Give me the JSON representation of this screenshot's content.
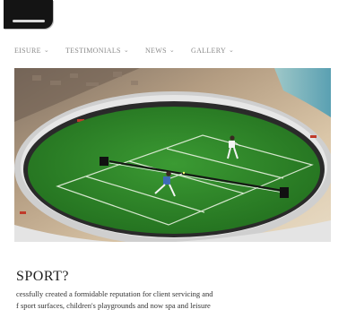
{
  "nav": {
    "items": [
      {
        "label": "EISURE",
        "chev": "⌄"
      },
      {
        "label": "TESTIMONIALS",
        "chev": "⌄"
      },
      {
        "label": "NEWS",
        "chev": "⌄"
      },
      {
        "label": "GALLERY",
        "chev": "⌄"
      }
    ]
  },
  "section": {
    "heading": "SPORT?",
    "lines": [
      "cessfully created a formidable reputation for client servicing and",
      "f sport surfaces, children's playgrounds and now spa and leisure"
    ]
  },
  "colors": {
    "court_green": "#2f8a2b",
    "court_dark": "#1c4a18",
    "ring": "#d9d9d9",
    "sand": "#cdb89a",
    "water": "#7fb7c6"
  },
  "icons": {
    "nav_dropdown": "chevron-down-icon",
    "logo": "logo-icon"
  }
}
